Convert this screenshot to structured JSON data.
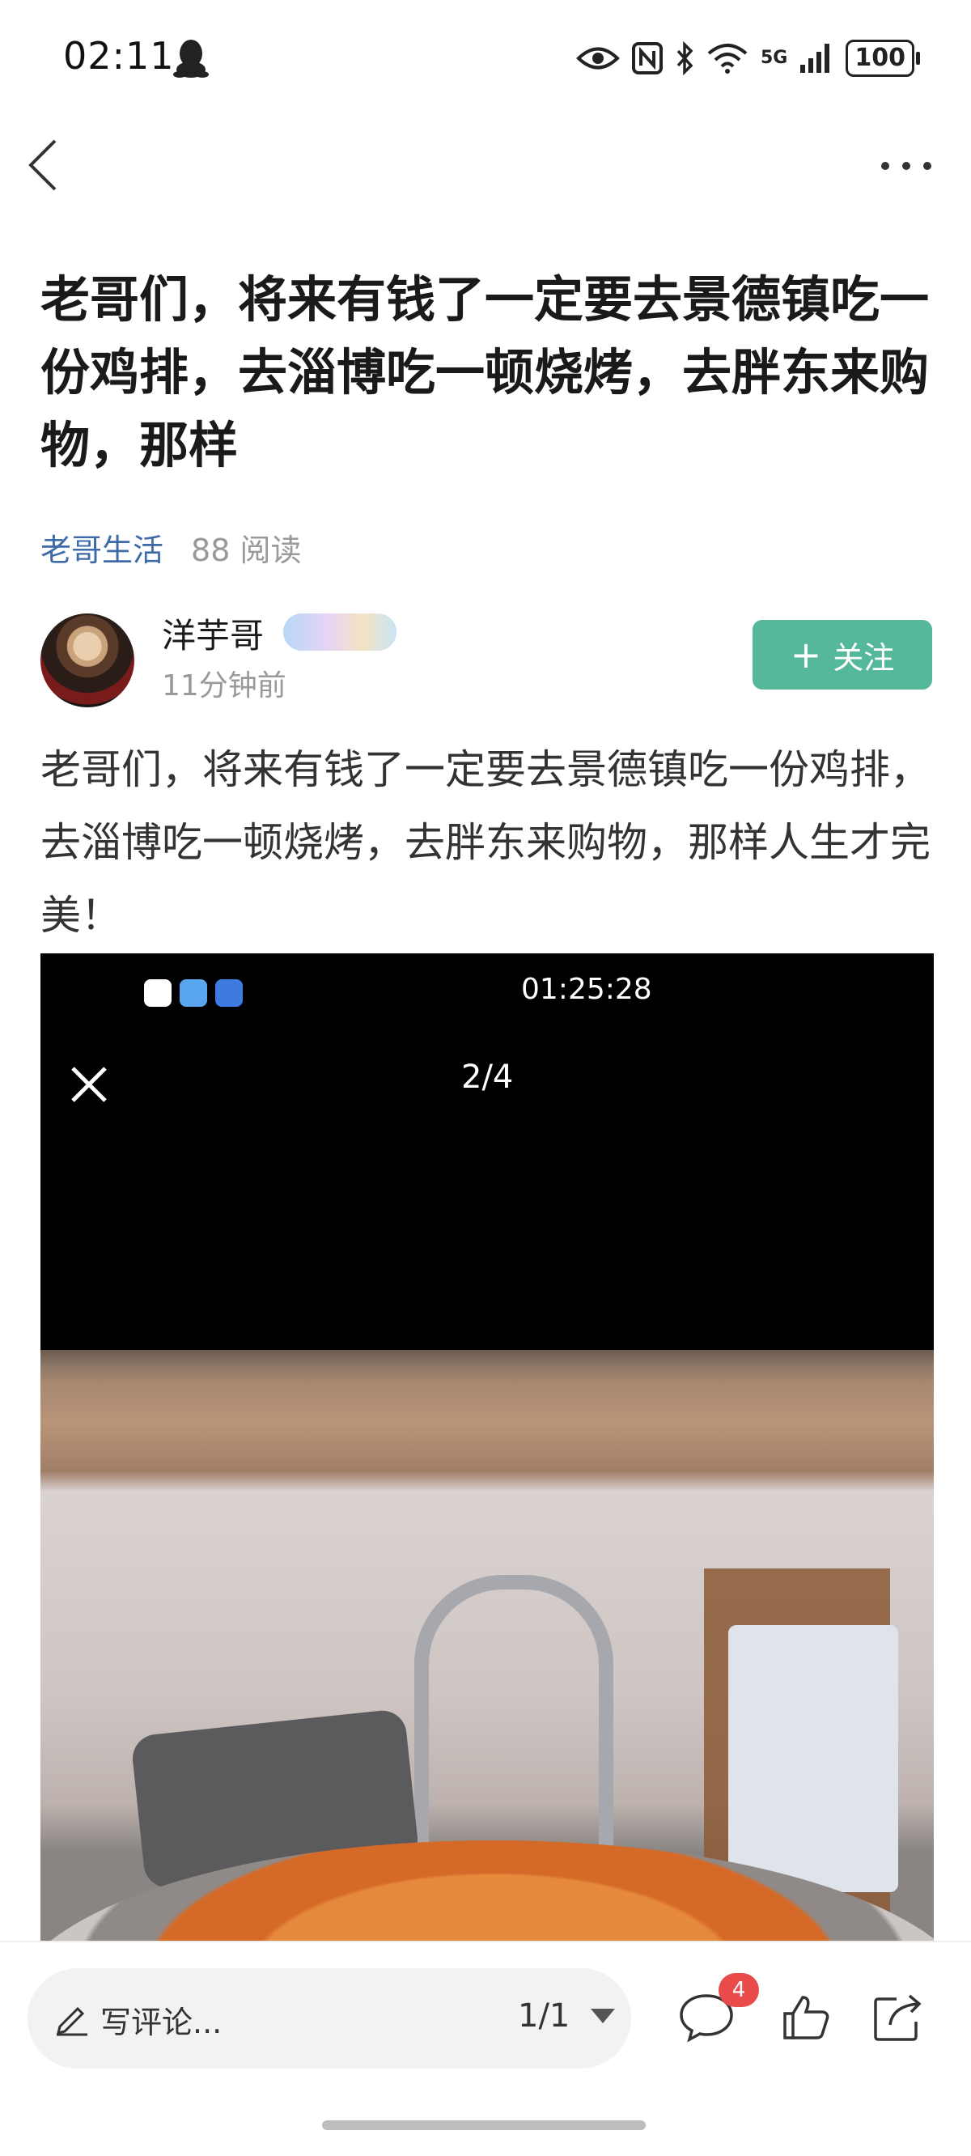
{
  "status_bar": {
    "time": "02:11",
    "network": "5G",
    "network_sup": "6",
    "battery": "100"
  },
  "post": {
    "title": "老哥们，将来有钱了一定要去景德镇吃一份鸡排，去淄博吃一顿烧烤，去胖东来购物，那样",
    "category": "老哥生活",
    "read_count": "88 阅读",
    "body": "老哥们，将来有钱了一定要去景德镇吃一份鸡排，去淄博吃一顿烧烤，去胖东来购物，那样人生才完美！"
  },
  "author": {
    "name": "洋芋哥",
    "time": "11分钟前",
    "follow_label": "关注",
    "follow_plus": "+"
  },
  "embedded_image": {
    "time": "01:25:28",
    "counter": "2/4"
  },
  "bottom_bar": {
    "comment_placeholder": "写评论...",
    "page_indicator": "1/1",
    "comment_count": "4"
  },
  "colors": {
    "accent_green": "#55b89a",
    "category_blue": "#3e6aa8",
    "badge_red": "#e94b4b"
  },
  "icons": [
    "back-icon",
    "more-icon",
    "qq-icon",
    "eye-icon",
    "nfc-icon",
    "bluetooth-icon",
    "wifi-icon",
    "signal-icon",
    "battery-icon",
    "close-icon",
    "pencil-icon",
    "comment-icon",
    "like-icon",
    "share-icon"
  ]
}
